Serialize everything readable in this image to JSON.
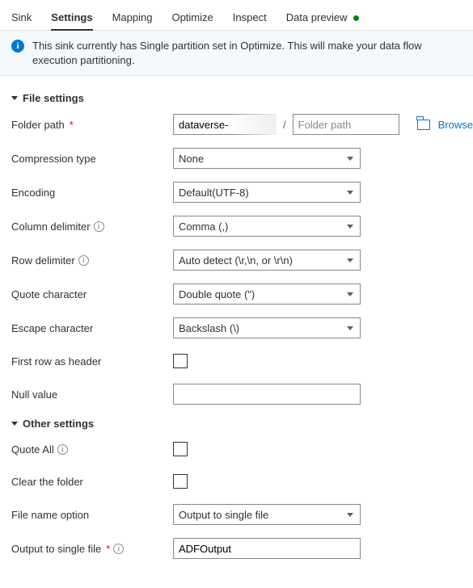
{
  "tabs": {
    "sink": "Sink",
    "settings": "Settings",
    "mapping": "Mapping",
    "optimize": "Optimize",
    "inspect": "Inspect",
    "data_preview": "Data preview"
  },
  "banner": {
    "text": "This sink currently has Single partition set in Optimize. This will make your data flow execution partitioning."
  },
  "sections": {
    "file_settings": "File settings",
    "other_settings": "Other settings"
  },
  "labels": {
    "folder_path": "Folder path",
    "compression_type": "Compression type",
    "encoding": "Encoding",
    "column_delimiter": "Column delimiter",
    "row_delimiter": "Row delimiter",
    "quote_character": "Quote character",
    "escape_character": "Escape character",
    "first_row_as_header": "First row as header",
    "null_value": "Null value",
    "quote_all": "Quote All",
    "clear_the_folder": "Clear the folder",
    "file_name_option": "File name option",
    "output_to_single_file": "Output to single file"
  },
  "values": {
    "folder_path_1": "dataverse-",
    "folder_path_2_placeholder": "Folder path",
    "browse": "Browse",
    "compression_type": "None",
    "encoding": "Default(UTF-8)",
    "column_delimiter": "Comma (,)",
    "row_delimiter": "Auto detect (\\r,\\n, or \\r\\n)",
    "quote_character": "Double quote (\")",
    "escape_character": "Backslash (\\)",
    "null_value": "",
    "file_name_option": "Output to single file",
    "output_to_single_file": "ADFOutput"
  },
  "required_marker": "*",
  "slash": "/"
}
